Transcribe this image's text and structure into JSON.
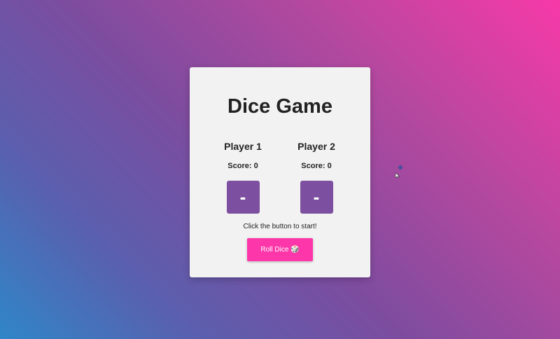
{
  "game": {
    "title": "Dice Game",
    "players": [
      {
        "name": "Player 1",
        "score_text": "Score: 0",
        "die_face": "-"
      },
      {
        "name": "Player 2",
        "score_text": "Score: 0",
        "die_face": "-"
      }
    ],
    "message": "Click the button to start!",
    "roll_button_label": "Roll Dice 🎲"
  },
  "colors": {
    "card_background": "#f2f2f2",
    "die_color": "#7c4fa0",
    "button_color": "#fd37a9",
    "gradient_start": "#f739a8",
    "gradient_end": "#2f86c8"
  }
}
